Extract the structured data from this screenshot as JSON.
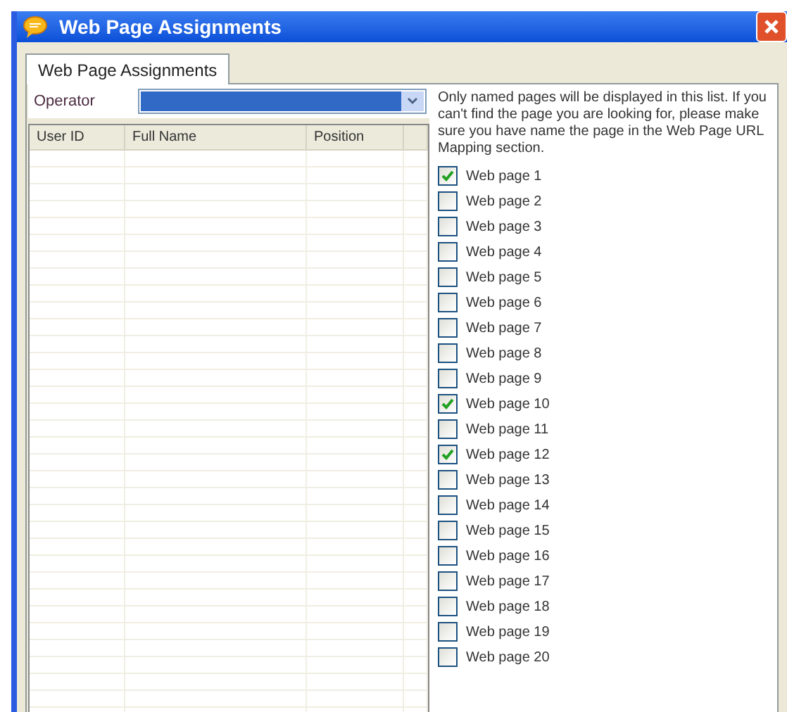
{
  "window": {
    "title": "Web Page Assignments"
  },
  "tabs": [
    {
      "label": "Web Page Assignments",
      "selected": true
    }
  ],
  "operator": {
    "label": "Operator"
  },
  "table": {
    "columns": [
      "User ID",
      "Full Name",
      "Position"
    ]
  },
  "note": "Only named pages will be displayed in this list. If you can't find the page you are looking for, please make sure you have name the page in the Web Page URL Mapping section.",
  "pages": [
    {
      "label": "Web page 1",
      "checked": true
    },
    {
      "label": "Web page 2",
      "checked": false
    },
    {
      "label": "Web page 3",
      "checked": false
    },
    {
      "label": "Web page 4",
      "checked": false
    },
    {
      "label": "Web page 5",
      "checked": false
    },
    {
      "label": "Web page 6",
      "checked": false
    },
    {
      "label": "Web page 7",
      "checked": false
    },
    {
      "label": "Web page 8",
      "checked": false
    },
    {
      "label": "Web page 9",
      "checked": false
    },
    {
      "label": "Web page 10",
      "checked": true
    },
    {
      "label": "Web page 11",
      "checked": false
    },
    {
      "label": "Web page 12",
      "checked": true
    },
    {
      "label": "Web page 13",
      "checked": false
    },
    {
      "label": "Web page 14",
      "checked": false
    },
    {
      "label": "Web page 15",
      "checked": false
    },
    {
      "label": "Web page 16",
      "checked": false
    },
    {
      "label": "Web page 17",
      "checked": false
    },
    {
      "label": "Web page 18",
      "checked": false
    },
    {
      "label": "Web page 19",
      "checked": false
    },
    {
      "label": "Web page 20",
      "checked": false
    }
  ]
}
